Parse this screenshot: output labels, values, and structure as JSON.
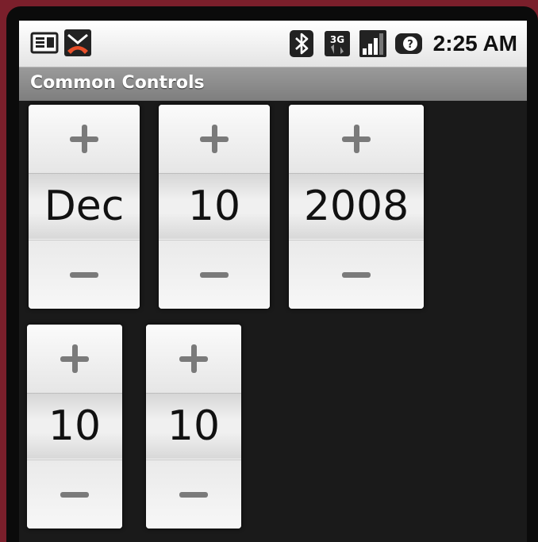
{
  "status_bar": {
    "icons_left": [
      "sim-card-icon",
      "missed-call-icon"
    ],
    "icons_right": [
      "bluetooth-icon",
      "3g-data-icon",
      "signal-strength-icon",
      "no-sim-icon"
    ],
    "network_label": "3G",
    "time": "2:25 AM"
  },
  "app": {
    "title": "Common Controls"
  },
  "date_picker": {
    "month": "Dec",
    "day": "10",
    "year": "2008"
  },
  "time_picker": {
    "hour": "10",
    "minute": "10"
  },
  "colors": {
    "frame": "#7a1f2b",
    "background": "#1a1a1a",
    "title_bar": "#8a8a8a",
    "missed_call": "#e8502a"
  }
}
